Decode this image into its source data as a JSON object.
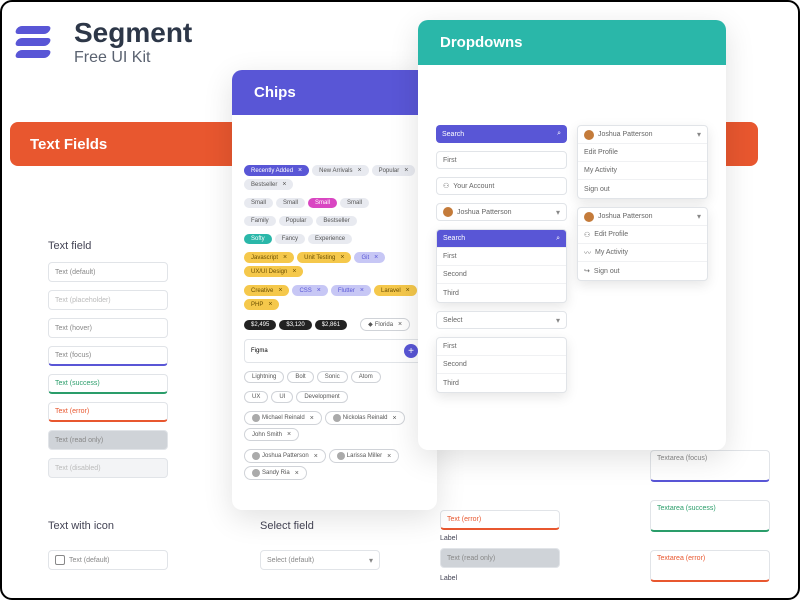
{
  "brand": {
    "title": "Segment",
    "subtitle": "Free UI Kit"
  },
  "panels": {
    "textfields": "Text Fields",
    "chips": "Chips",
    "dropdowns": "Dropdowns"
  },
  "tf": {
    "heading": "Text field",
    "default": "Text (default)",
    "placeholder": "Text (placeholder)",
    "hover": "Text (hover)",
    "focus": "Text (focus)",
    "success": "Text (success)",
    "error": "Text (error)",
    "readonly": "Text (read only)",
    "disabled": "Text (disabled)",
    "with_icon": "Text with icon",
    "icon_default": "Text (default)"
  },
  "chips": {
    "recently_added": "Recently Added",
    "new_arrivals": "New Arrivals",
    "popular": "Popular",
    "bestseller": "Bestseller",
    "small1": "Small",
    "small2": "Small",
    "small3": "Small",
    "small4": "Small",
    "family": "Family",
    "popular2": "Popular",
    "bestseller2": "Bestseller",
    "softy": "Softy",
    "fancy": "Fancy",
    "experience": "Experience",
    "y1": "Javascript",
    "y2": "Unit Testing",
    "y3": "Git",
    "y4": "UX/UI Design",
    "y5": "Creative",
    "y6": "CSS",
    "y7": "Flutter",
    "y8": "Laravel",
    "y9": "PHP",
    "price1": "$2,495",
    "price2": "$3,120",
    "price3": "$2,861",
    "loc": "Florida",
    "input_label": "Figma",
    "t1": "Lightning",
    "t2": "Bolt",
    "t3": "Sonic",
    "t4": "Atom",
    "tag1": "UX",
    "tag2": "UI",
    "tag3": "Development",
    "p1": "Michael Reinald",
    "p2": "Nickolas Reinald",
    "p3": "John Smith",
    "p4": "Joshua Patterson",
    "p5": "Larissa Miller",
    "p6": "Sandy Ria"
  },
  "dd": {
    "search": "Search",
    "first": "First",
    "second": "Second",
    "third": "Third",
    "your_account": "Your Account",
    "user": "Joshua Patterson",
    "edit_profile": "Edit Profile",
    "my_activity": "My Activity",
    "sign_out": "Sign out",
    "select": "Select"
  },
  "lower": {
    "select_field": "Select field",
    "select_default": "Select (default)",
    "text_error": "Text (error)",
    "label": "Label",
    "text_readonly": "Text (read only)",
    "ta_focus": "Textarea (focus)",
    "ta_success": "Textarea (success)",
    "ta_error": "Textarea (error)"
  }
}
